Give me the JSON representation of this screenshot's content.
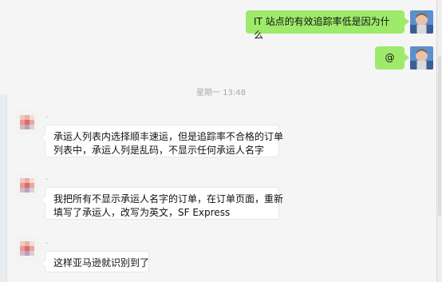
{
  "messages": [
    {
      "side": "right",
      "text": "IT 站点的有效追踪率低是因为什么"
    },
    {
      "side": "right",
      "text": "@"
    }
  ],
  "timestamp": "星期一 13:48",
  "incoming": [
    {
      "sender": ".",
      "lines": [
        "承运人列表内选择顺丰速运，但是追踪率不合格的订单",
        "列表中，承运人列是乱码，不显示任何承运人名字"
      ]
    },
    {
      "sender": ".",
      "lines": [
        "我把所有不显示承运人名字的订单，在订单页面，重新",
        "填写了承运人，改写为英文，SF Express"
      ]
    },
    {
      "sender": ".",
      "lines": [
        "这样亚马逊就识别到了"
      ]
    }
  ],
  "colors": {
    "outgoing_bubble": "#9eea6a",
    "incoming_bubble": "#ffffff",
    "background": "#f5f5f5"
  }
}
